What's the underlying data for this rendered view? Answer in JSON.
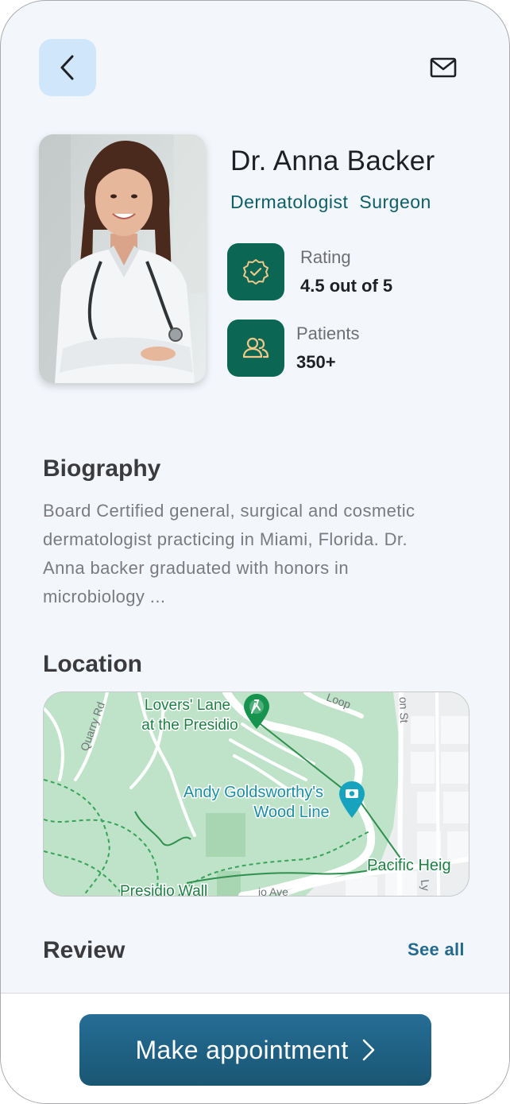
{
  "header": {
    "back_icon": "chevron-left-icon",
    "mail_icon": "mail-icon"
  },
  "doctor": {
    "name": "Dr. Anna Backer",
    "specialties": [
      "Dermatologist",
      "Surgeon"
    ],
    "photo": "doctor-portrait"
  },
  "stats": [
    {
      "icon": "verified-badge-icon",
      "label": "Rating",
      "value": "4.5 out of 5"
    },
    {
      "icon": "patients-icon",
      "label": "Patients",
      "value": "350+"
    }
  ],
  "biography": {
    "title": "Biography",
    "lines": [
      "Board Certified general, surgical and cosmetic",
      "dermatologist practicing in Miami, Florida.  Dr.",
      "Anna backer graduated with honors in",
      "microbiology ..."
    ]
  },
  "location": {
    "title": "Location",
    "map_labels": {
      "poi1_line1": "Lovers' Lane",
      "poi1_line2": "at the Presidio",
      "poi2_line1": "Andy Goldsworthy's",
      "poi2_line2": "Wood Line",
      "area": "Pacific Heig",
      "wall": "Presidio Wall",
      "road_quarry": "Quarry Rd",
      "road_loop": "Loop",
      "road_st": "on St",
      "road_ave": "io Ave",
      "road_ly": "Ly"
    }
  },
  "review": {
    "title": "Review",
    "see_all": "See all"
  },
  "cta": {
    "label": "Make  appointment"
  },
  "colors": {
    "accent_teal": "#0b6654",
    "specialty_text": "#0d5e66",
    "back_button_bg": "#cfe6fb",
    "cta_bg": "#1f6384",
    "link": "#246a8e"
  }
}
